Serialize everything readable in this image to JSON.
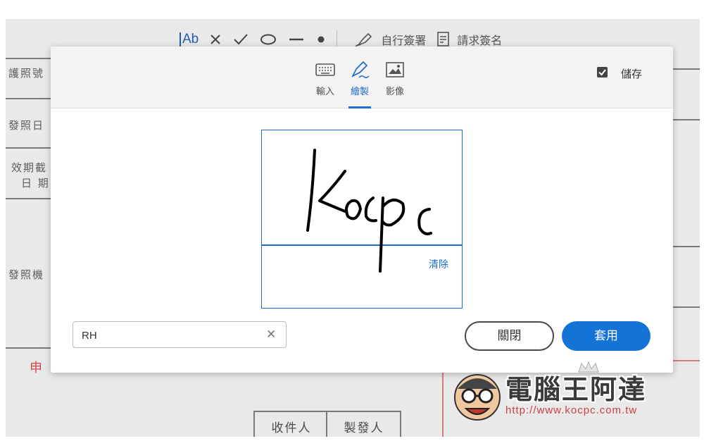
{
  "toolbar": {
    "text_tool": "Ab",
    "self_sign_label": "自行簽署",
    "request_sign_label": "請求簽名"
  },
  "document": {
    "labels": [
      "護照號",
      "發照日",
      "效期截",
      "日 期",
      "發照機"
    ],
    "red_text": "申",
    "cells": [
      "收件人",
      "製發人"
    ]
  },
  "modal": {
    "tabs": [
      {
        "label": "輸入",
        "icon": "keyboard-icon",
        "active": false
      },
      {
        "label": "繪製",
        "icon": "pen-draw-icon",
        "active": true
      },
      {
        "label": "影像",
        "icon": "image-icon",
        "active": false
      }
    ],
    "save_label": "儲存",
    "save_checked": true,
    "signature_text": "Kocpc",
    "clear_label": "清除",
    "initials_value": "RH",
    "close_label": "關閉",
    "apply_label": "套用",
    "accent_color": "#1473d6"
  },
  "watermark": {
    "title": "電腦王阿達",
    "url": "http://www.kocpc.com.tw"
  }
}
